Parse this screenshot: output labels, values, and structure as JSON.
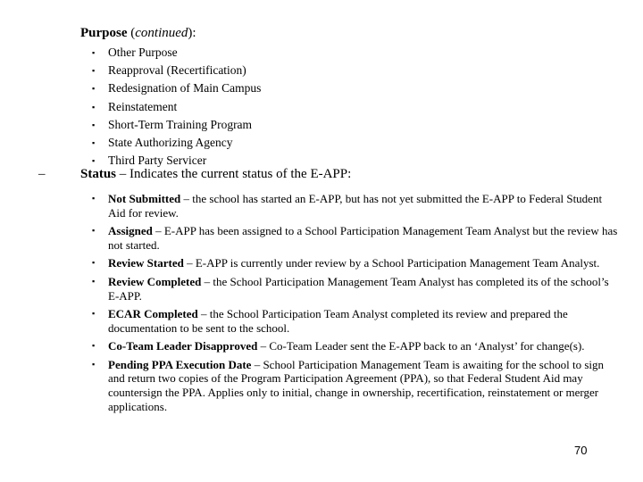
{
  "heading": {
    "bold": "Purpose",
    "italic": "continued",
    "open": " (",
    "close": "):"
  },
  "purpose_items": [
    "Other Purpose",
    "Reapproval (Recertification)",
    "Redesignation of Main Campus",
    "Reinstatement",
    "Short-Term Training Program",
    "State Authorizing Agency",
    "Third Party Servicer"
  ],
  "bullet_glyph": "▪",
  "status": {
    "dash": "–",
    "label": "Status",
    "text": " – Indicates the current status of the E-APP:"
  },
  "status_items": [
    {
      "term": "Not Submitted",
      "desc": " – the school has started an E-APP, but has not yet submitted the E-APP to Federal Student Aid for review."
    },
    {
      "term": "Assigned",
      "desc": " – E-APP has been assigned to a School Participation Management Team Analyst but the review has not started."
    },
    {
      "term": "Review Started",
      "desc": " – E-APP is currently under review by a School Participation Management Team Analyst."
    },
    {
      "term": "Review Completed",
      "desc": " – the School Participation Management Team Analyst has completed its of the school’s E-APP."
    },
    {
      "term": "ECAR Completed",
      "desc": " – the School Participation Team Analyst completed its review and prepared the documentation to be sent to the school."
    },
    {
      "term": "Co-Team Leader Disapproved",
      "desc": " – Co-Team Leader sent the E-APP back to an ‘Analyst’ for change(s)."
    },
    {
      "term": "Pending PPA Execution Date",
      "desc": " – School Participation Management Team is awaiting for the school to sign and return two copies of the Program Participation Agreement (PPA), so that Federal Student Aid may countersign the PPA.  Applies only to initial, change in ownership, recertification, reinstatement or  merger applications."
    }
  ],
  "page_number": "70"
}
